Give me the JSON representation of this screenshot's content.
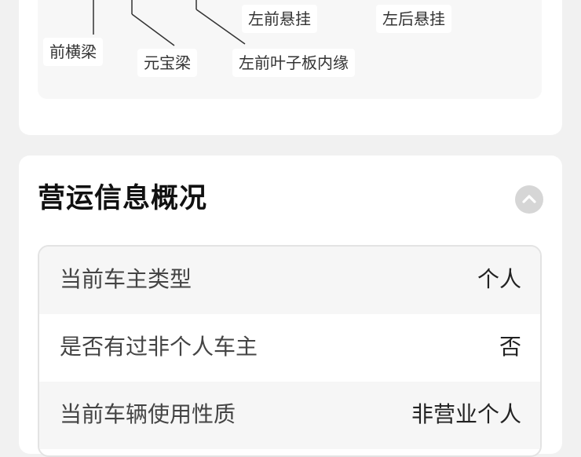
{
  "diagram": {
    "labels": {
      "front_crossbeam": "前横梁",
      "yuanbao_beam": "元宝梁",
      "left_front_leaf_spring_inner": "左前叶子板内缘",
      "left_front_suspension": "左前悬挂",
      "left_rear_suspension": "左后悬挂"
    }
  },
  "operations": {
    "title": "营运信息概况",
    "rows": [
      {
        "label": "当前车主类型",
        "value": "个人"
      },
      {
        "label": "是否有过非个人车主",
        "value": "否"
      },
      {
        "label": "当前车辆使用性质",
        "value": "非营业个人"
      }
    ]
  },
  "icons": {
    "collapse": "chevron-up-icon"
  },
  "colors": {
    "background": "#f1f1f1",
    "card": "#ffffff",
    "row_shade": "#f6f6f6",
    "collapse_button": "#d6d6d6"
  }
}
